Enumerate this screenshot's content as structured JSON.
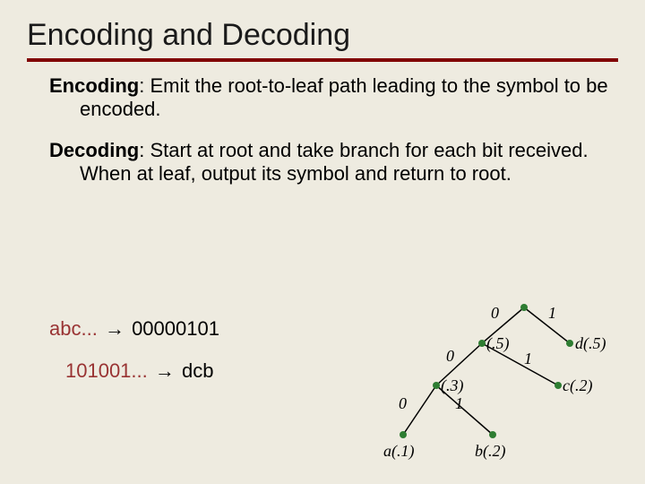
{
  "title": "Encoding and Decoding",
  "para1": {
    "term": "Encoding",
    "text": ": Emit the root-to-leaf path leading to the symbol to be encoded."
  },
  "para2": {
    "term": "Decoding",
    "text": ": Start at root and take branch for each bit received.  When at leaf, output its symbol and return to root."
  },
  "example1": {
    "src": "abc...",
    "arrow": "→",
    "dst": "00000101"
  },
  "example2": {
    "src": "101001...",
    "arrow": "→",
    "dst": "dcb"
  },
  "tree": {
    "root_left": "0",
    "root_right": "1",
    "n5": "(.5)",
    "d": "d(.5)",
    "n5_left": "0",
    "n5_right": "1",
    "n3": "(.3)",
    "c": "c(.2)",
    "n3_left": "0",
    "n3_right": "1",
    "a": "a(.1)",
    "b": "b(.2)"
  }
}
